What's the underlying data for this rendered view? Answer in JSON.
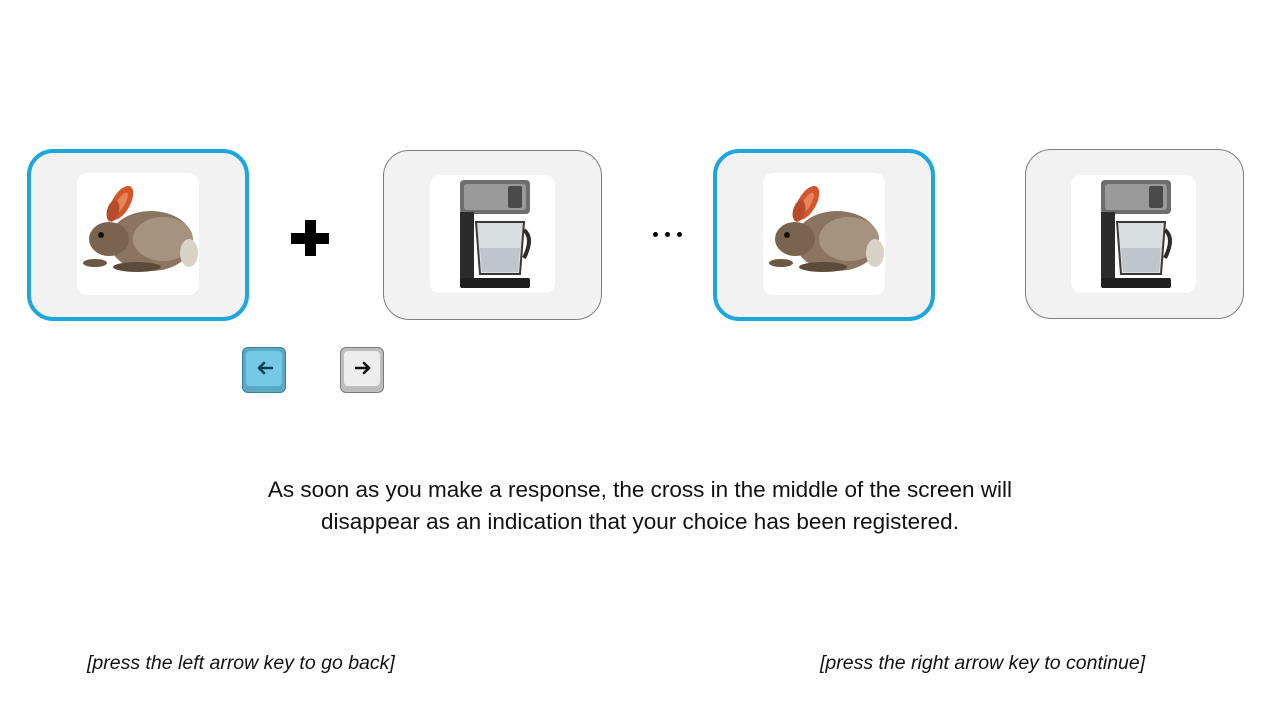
{
  "stimuli": [
    {
      "image": "rabbit",
      "selected": true
    },
    {
      "image": "coffee-maker",
      "selected": false
    },
    {
      "image": "rabbit",
      "selected": true
    },
    {
      "image": "coffee-maker",
      "selected": false
    }
  ],
  "fixation_symbol": "plus-icon",
  "sequence_separator": "ellipsis-icon",
  "keys": {
    "left": {
      "icon": "left-arrow-icon",
      "state": "pressed",
      "color": "#74c9e6"
    },
    "right": {
      "icon": "right-arrow-icon",
      "state": "idle",
      "color": "#ededed"
    }
  },
  "selection_color": "#1ca8dd",
  "instruction": {
    "line1": "As soon as you make a response, the cross in the middle of the screen will",
    "line2": "disappear as an indication that your choice has been registered."
  },
  "navigation": {
    "back": "[press the left arrow key to go back]",
    "forward": "[press the right arrow key to continue]"
  }
}
